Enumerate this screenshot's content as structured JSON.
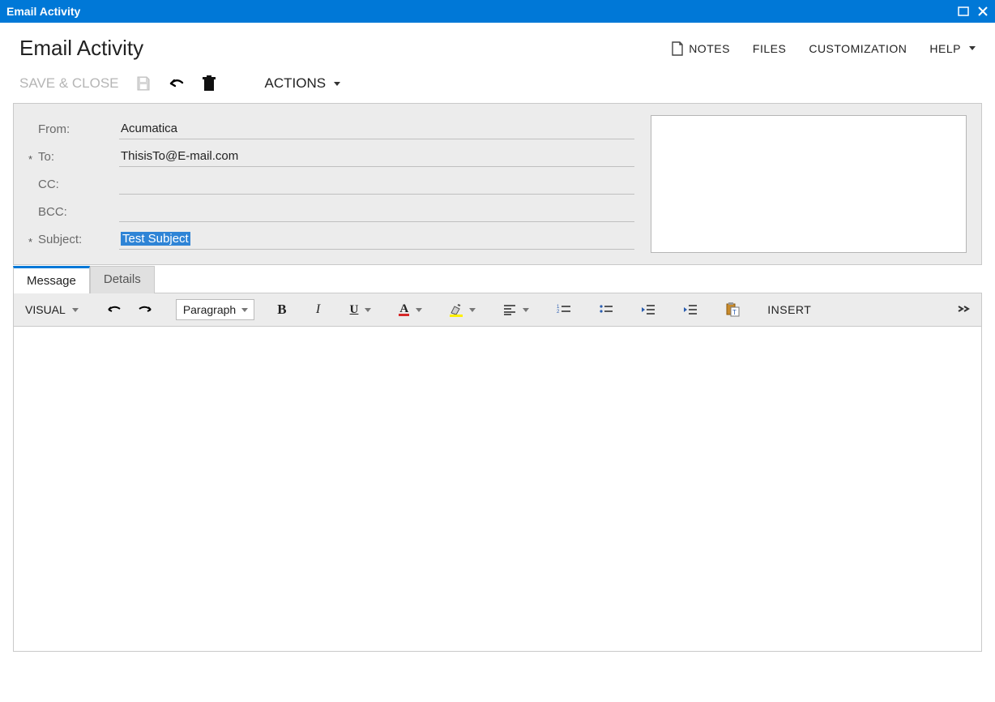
{
  "window": {
    "title": "Email Activity"
  },
  "page": {
    "title": "Email Activity"
  },
  "headerLinks": {
    "notes": "NOTES",
    "files": "FILES",
    "customization": "CUSTOMIZATION",
    "help": "HELP"
  },
  "toolbar": {
    "saveClose": "SAVE & CLOSE",
    "actions": "ACTIONS"
  },
  "fields": {
    "fromLabel": "From:",
    "fromValue": "Acumatica",
    "toLabel": "To:",
    "toValue": "ThisisTo@E-mail.com",
    "ccLabel": "CC:",
    "ccValue": "",
    "bccLabel": "BCC:",
    "bccValue": "",
    "subjectLabel": "Subject:",
    "subjectValue": "Test Subject"
  },
  "tabs": {
    "message": "Message",
    "details": "Details"
  },
  "editor": {
    "visual": "VISUAL",
    "paragraph": "Paragraph",
    "insert": "INSERT",
    "icons": {
      "undo": "undo",
      "redo": "redo",
      "bold": "B",
      "italic": "I",
      "underline": "U",
      "fontColor": "A",
      "highlight": "highlight",
      "align": "align",
      "numlist": "numlist",
      "bullist": "bullist",
      "outdent": "outdent",
      "indent": "indent",
      "paste": "paste",
      "expand": "expand"
    }
  }
}
